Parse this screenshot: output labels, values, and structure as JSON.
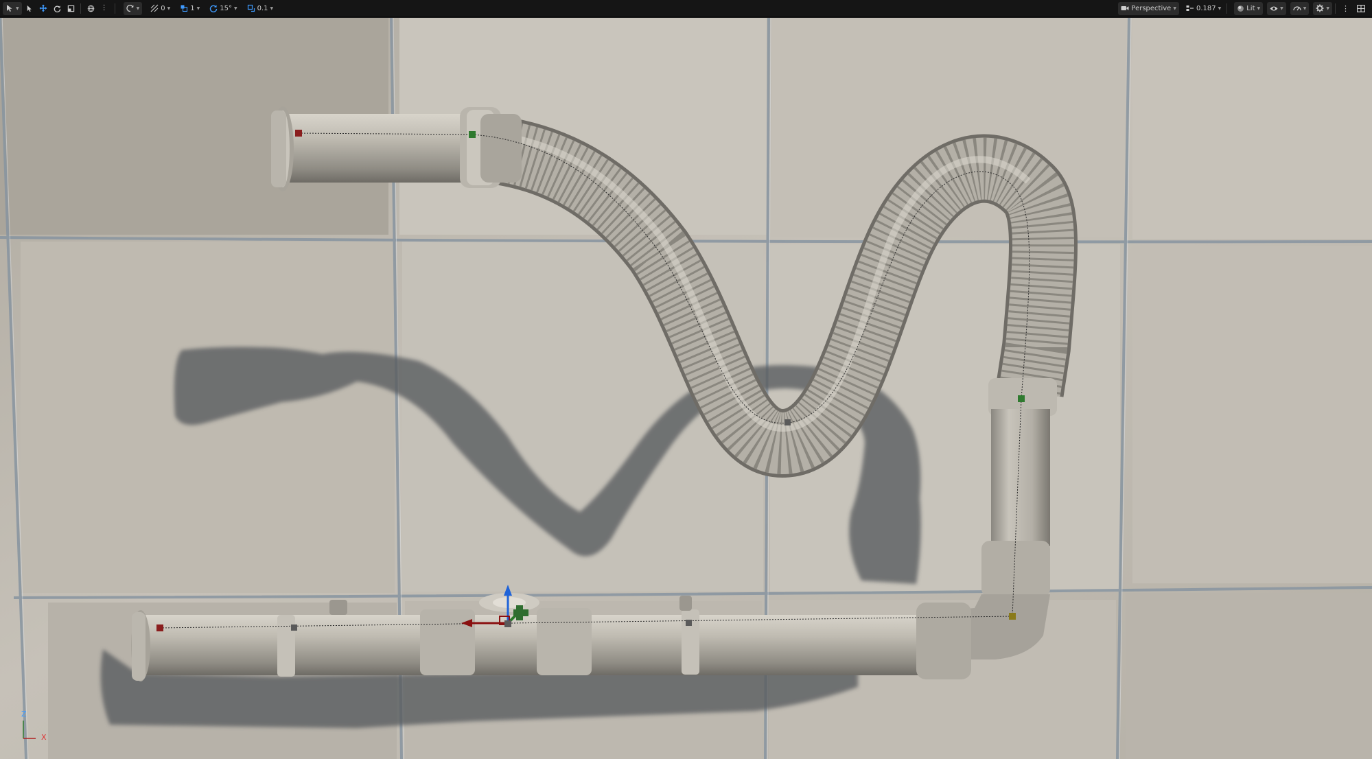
{
  "toolbar": {
    "left": {
      "select_mode_icon": "select-mode-icon",
      "tools": [
        "select-arrow-icon",
        "move-icon",
        "rotate-icon",
        "scale-icon"
      ],
      "world_icon": "globe-icon",
      "surface_snap_icon": "surface-snap-icon",
      "grid_snap_value": "0",
      "grid_snap_icon": "grid-snap-icon",
      "location_snap_value": "1",
      "location_snap_icon": "location-snap-icon",
      "rotation_snap_value": "15°",
      "rotation_snap_icon": "rotation-snap-icon",
      "scale_snap_value": "0.1",
      "scale_snap_icon": "scale-snap-icon"
    },
    "right": {
      "view_mode_label": "Perspective",
      "view_mode_icon": "camera-icon",
      "camera_speed_value": "0.187",
      "camera_speed_icon": "camera-speed-icon",
      "lighting_mode_label": "Lit",
      "lighting_icon": "lit-sphere-icon",
      "show_icon": "eye-icon",
      "performance_icon": "gauge-icon",
      "settings_icon": "gear-icon",
      "menu_icon": "kebab-menu-icon",
      "layout_icon": "layout-grid-icon"
    }
  },
  "axis_indicator": {
    "z_label": "Z",
    "x_label": "X"
  },
  "colors": {
    "accent_blue": "#3f9bff",
    "wall_tile": "#c2bdb4",
    "tile_seam": "#8794a0",
    "pipe": "#b3afa6",
    "pipe_dark": "#7d7a73",
    "shadow": "#55585c",
    "spline_point_start": "#8a1d1d",
    "spline_point_end": "#2f7a2f",
    "spline_point_mid": "#5a5a5a",
    "spline_point_corner": "#8a7a1a",
    "gizmo_x": "#8a1010",
    "gizmo_z": "#1f63d8",
    "gizmo_y": "#2a7a2a"
  }
}
